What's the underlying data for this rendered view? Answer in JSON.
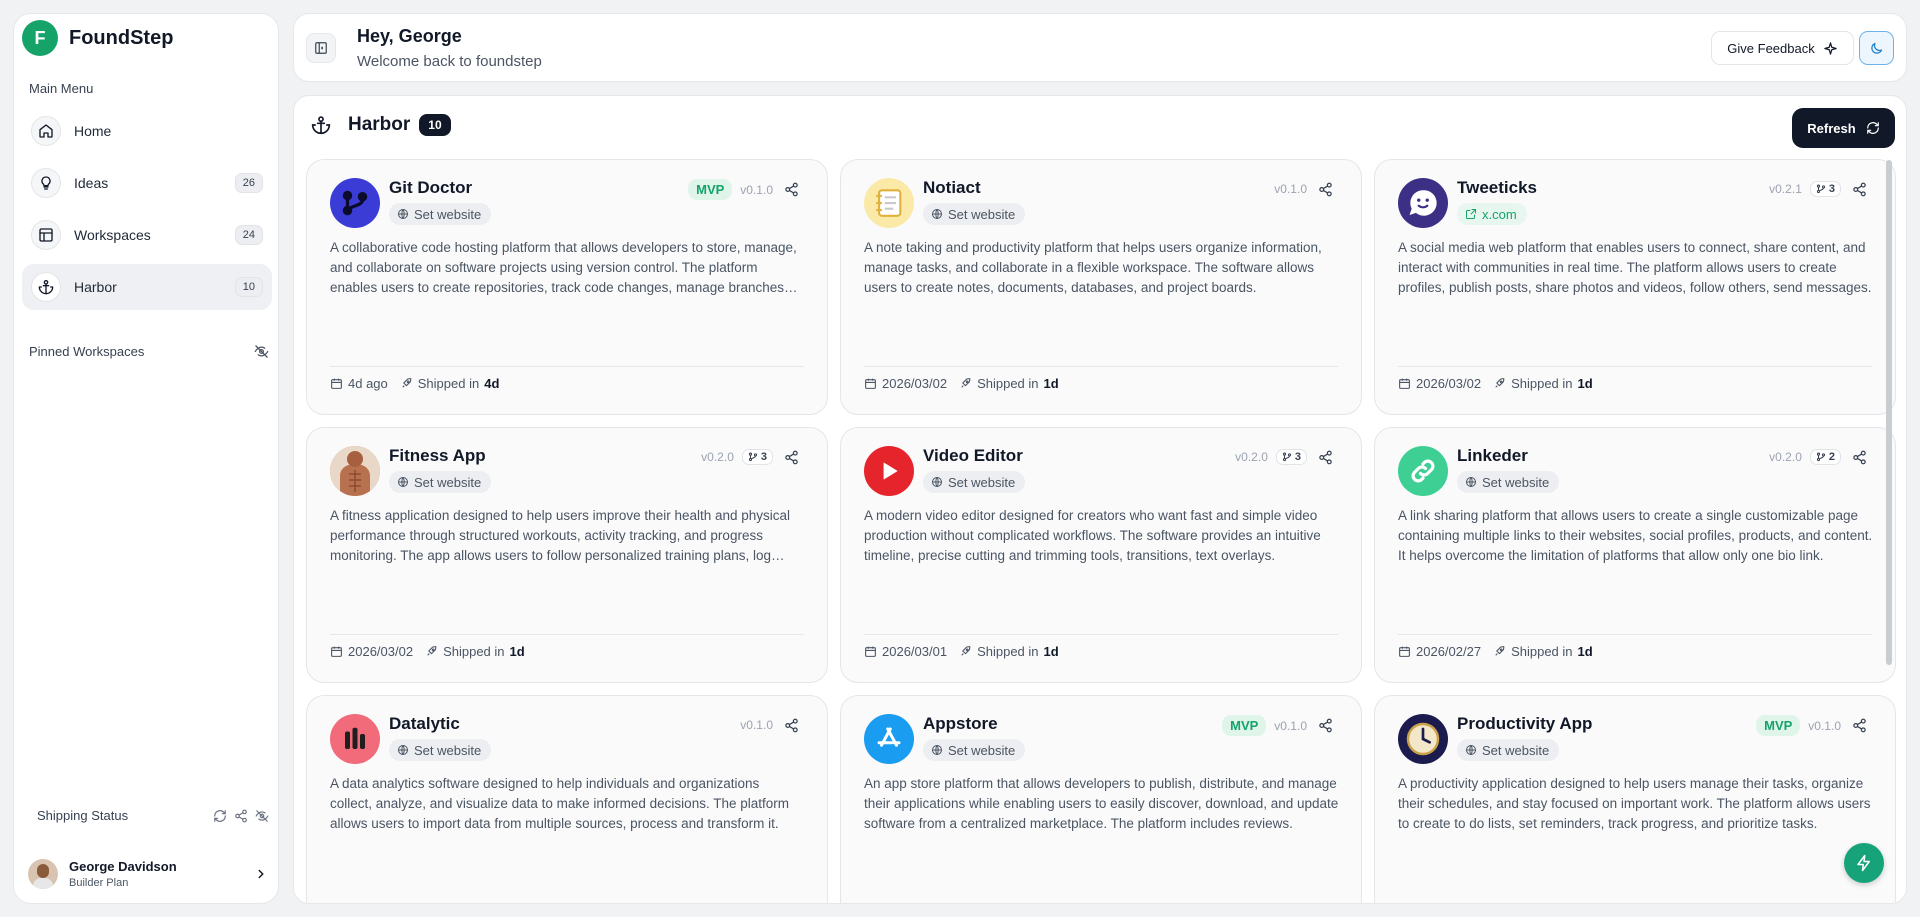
{
  "brand": {
    "name": "FoundStep",
    "logo_letter": "F"
  },
  "sidebar": {
    "menu_title": "Main Menu",
    "items": [
      {
        "label": "Home",
        "count": null
      },
      {
        "label": "Ideas",
        "count": "26"
      },
      {
        "label": "Workspaces",
        "count": "24"
      },
      {
        "label": "Harbor",
        "count": "10"
      }
    ],
    "pinned_title": "Pinned Workspaces",
    "shipping_status": "Shipping Status",
    "user": {
      "name": "George Davidson",
      "plan": "Builder Plan"
    }
  },
  "header": {
    "greeting": "Hey, George",
    "welcome": "Welcome back to foundstep",
    "feedback_label": "Give Feedback"
  },
  "main": {
    "title": "Harbor",
    "count": "10",
    "refresh_label": "Refresh"
  },
  "cards": [
    {
      "title": "Git Doctor",
      "website": "Set website",
      "mvp": "MVP",
      "version": "v0.1.0",
      "branches": null,
      "description": "A collaborative code hosting platform that allows developers to store, manage, and collaborate on software projects using version control. The platform enables users to create repositories, track code changes, manage branches and pull requests.",
      "date": "4d ago",
      "shipped_prefix": "Shipped in",
      "shipped": "4d"
    },
    {
      "title": "Notiact",
      "website": "Set website",
      "mvp": null,
      "version": "v0.1.0",
      "branches": null,
      "description": "A note taking and productivity platform that helps users organize information, manage tasks, and collaborate in a flexible workspace. The software allows users to create notes, documents, databases, and project boards.",
      "date": "2026/03/02",
      "shipped_prefix": "Shipped in",
      "shipped": "1d"
    },
    {
      "title": "Tweeticks",
      "website": "x.com",
      "mvp": null,
      "version": "v0.2.1",
      "branches": "3",
      "description": "A social media web platform that enables users to connect, share content, and interact with communities in real time. The platform allows users to create profiles, publish posts, share photos and videos, follow others, send messages.",
      "date": "2026/03/02",
      "shipped_prefix": "Shipped in",
      "shipped": "1d"
    },
    {
      "title": "Fitness App",
      "website": "Set website",
      "mvp": null,
      "version": "v0.2.0",
      "branches": "3",
      "description": "A fitness application designed to help users improve their health and physical performance through structured workouts, activity tracking, and progress monitoring. The app allows users to follow personalized training plans, log workouts.",
      "date": "2026/03/02",
      "shipped_prefix": "Shipped in",
      "shipped": "1d"
    },
    {
      "title": "Video Editor",
      "website": "Set website",
      "mvp": null,
      "version": "v0.2.0",
      "branches": "3",
      "description": "A modern video editor designed for creators who want fast and simple video production without complicated workflows. The software provides an intuitive timeline, precise cutting and trimming tools, transitions, text overlays.",
      "date": "2026/03/01",
      "shipped_prefix": "Shipped in",
      "shipped": "1d"
    },
    {
      "title": "Linkeder",
      "website": "Set website",
      "mvp": null,
      "version": "v0.2.0",
      "branches": "2",
      "description": "A link sharing platform that allows users to create a single customizable page containing multiple links to their websites, social profiles, products, and content. It helps overcome the limitation of platforms that allow only one bio link.",
      "date": "2026/02/27",
      "shipped_prefix": "Shipped in",
      "shipped": "1d"
    },
    {
      "title": "Datalytic",
      "website": "Set website",
      "mvp": null,
      "version": "v0.1.0",
      "branches": null,
      "description": "A data analytics software designed to help individuals and organizations collect, analyze, and visualize data to make informed decisions. The platform allows users to import data from multiple sources, process and transform it.",
      "date": "",
      "shipped_prefix": "",
      "shipped": ""
    },
    {
      "title": "Appstore",
      "website": "Set website",
      "mvp": "MVP",
      "version": "v0.1.0",
      "branches": null,
      "description": "An app store platform that allows developers to publish, distribute, and manage their applications while enabling users to easily discover, download, and update software from a centralized marketplace. The platform includes reviews.",
      "date": "",
      "shipped_prefix": "",
      "shipped": ""
    },
    {
      "title": "Productivity App",
      "website": "Set website",
      "mvp": "MVP",
      "version": "v0.1.0",
      "branches": null,
      "description": "A productivity application designed to help users manage their tasks, organize their schedules, and stay focused on important work. The platform allows users to create to do lists, set reminders, track progress, and prioritize tasks.",
      "date": "",
      "shipped_prefix": "",
      "shipped": ""
    }
  ],
  "colors": {
    "accent": "#16a36a",
    "dark": "#111827",
    "mvp_bg": "#dff5ea"
  }
}
